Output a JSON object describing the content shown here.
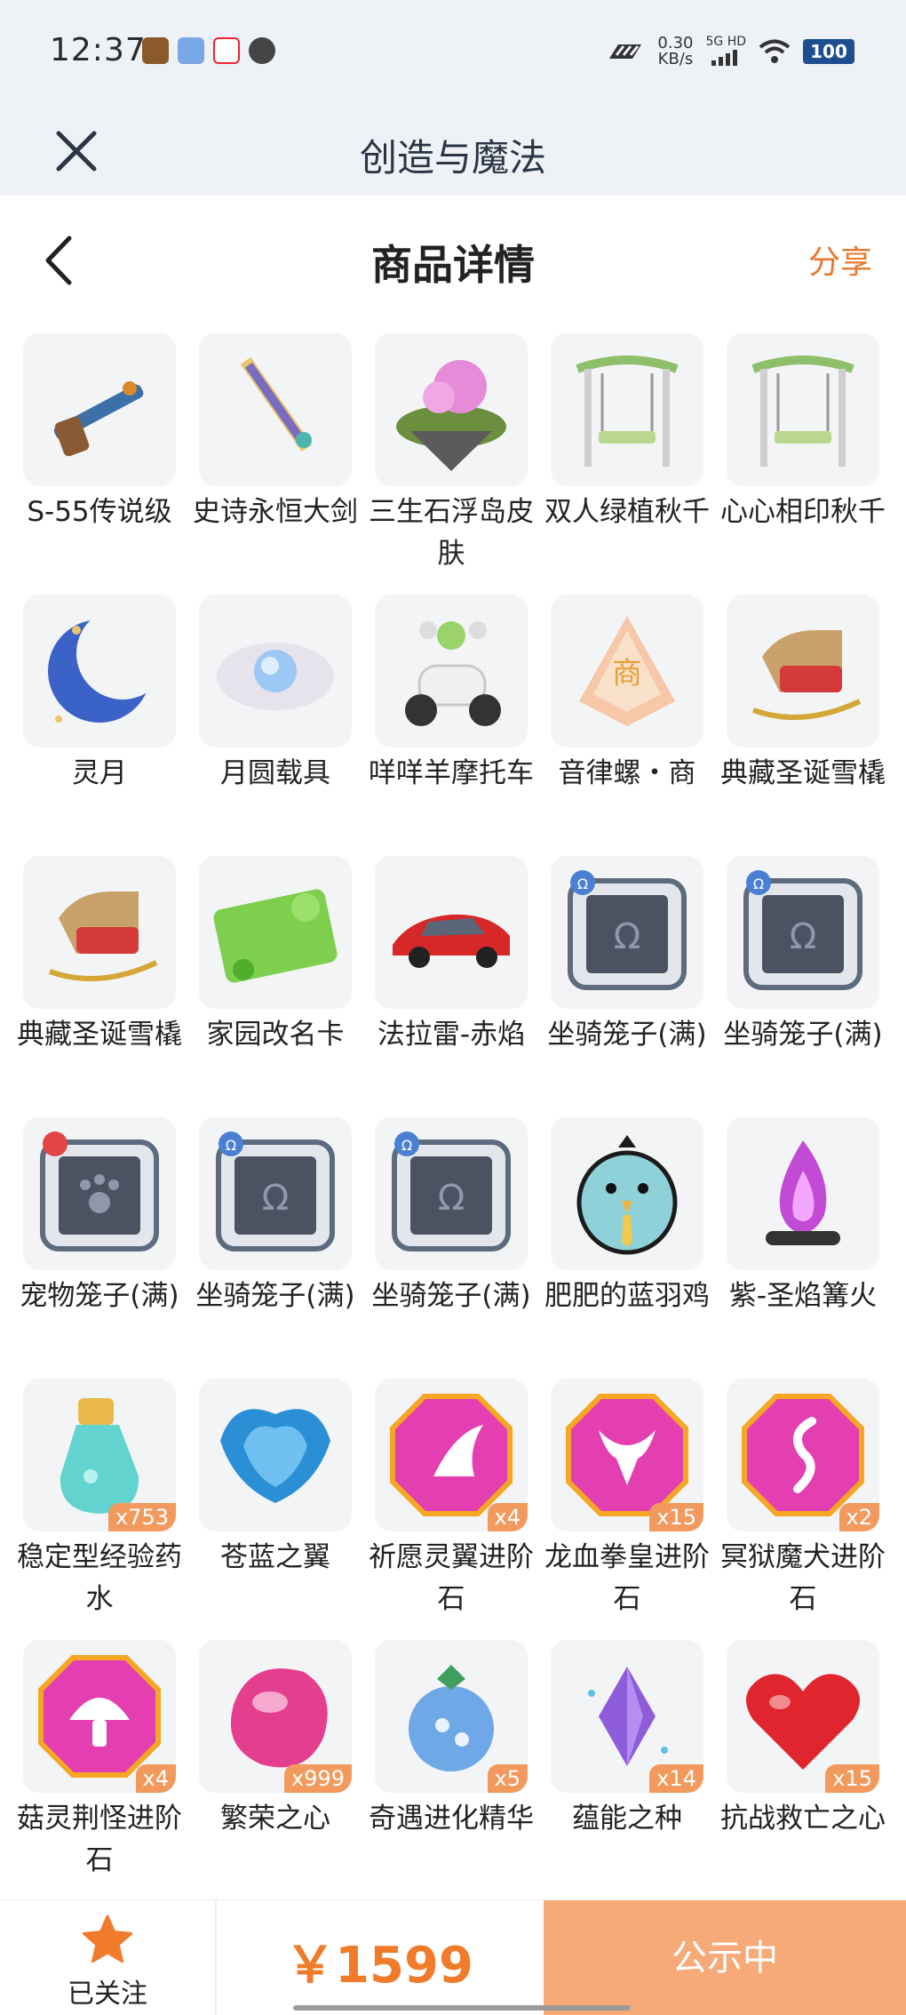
{
  "status_bar": {
    "time": "12:37",
    "net_speed_value": "0.30",
    "net_speed_unit": "KB/s",
    "network": "5G HD",
    "battery": "100"
  },
  "app": {
    "title": "创造与魔法"
  },
  "header": {
    "title": "商品详情",
    "share_label": "分享"
  },
  "items": [
    {
      "name": "S-55传说级",
      "icon": "gun-icon",
      "badge": ""
    },
    {
      "name": "史诗永恒大剑",
      "icon": "sword-icon",
      "badge": ""
    },
    {
      "name": "三生石浮岛皮肤",
      "icon": "floating-island-icon",
      "badge": ""
    },
    {
      "name": "双人绿植秋千",
      "icon": "swing-icon",
      "badge": ""
    },
    {
      "name": "心心相印秋千",
      "icon": "swing-icon",
      "badge": ""
    },
    {
      "name": "灵月",
      "icon": "crescent-moon-icon",
      "badge": ""
    },
    {
      "name": "月圆载具",
      "icon": "cloud-moon-icon",
      "badge": ""
    },
    {
      "name": "咩咩羊摩托车",
      "icon": "scooter-icon",
      "badge": ""
    },
    {
      "name": "音律螺・商",
      "icon": "conch-icon",
      "badge": ""
    },
    {
      "name": "典藏圣诞雪橇",
      "icon": "sleigh-icon",
      "badge": ""
    },
    {
      "name": "典藏圣诞雪橇",
      "icon": "sleigh-icon",
      "badge": ""
    },
    {
      "name": "家园改名卡",
      "icon": "clover-card-icon",
      "badge": ""
    },
    {
      "name": "法拉雷-赤焰",
      "icon": "red-car-icon",
      "badge": ""
    },
    {
      "name": "坐骑笼子(满)",
      "icon": "mount-cage-icon",
      "badge": ""
    },
    {
      "name": "坐骑笼子(满)",
      "icon": "mount-cage-icon",
      "badge": ""
    },
    {
      "name": "宠物笼子(满)",
      "icon": "pet-cage-icon",
      "badge": ""
    },
    {
      "name": "坐骑笼子(满)",
      "icon": "mount-cage-icon",
      "badge": ""
    },
    {
      "name": "坐骑笼子(满)",
      "icon": "mount-cage-icon",
      "badge": ""
    },
    {
      "name": "肥肥的蓝羽鸡",
      "icon": "blue-bird-icon",
      "badge": ""
    },
    {
      "name": "紫-圣焰篝火",
      "icon": "bonfire-icon",
      "badge": ""
    },
    {
      "name": "稳定型经验药水",
      "icon": "potion-icon",
      "badge": "x753"
    },
    {
      "name": "苍蓝之翼",
      "icon": "blue-wings-icon",
      "badge": ""
    },
    {
      "name": "祈愿灵翼进阶石",
      "icon": "wing-gem-icon",
      "badge": "x4"
    },
    {
      "name": "龙血拳皇进阶石",
      "icon": "bull-gem-icon",
      "badge": "x15"
    },
    {
      "name": "冥狱魔犬进阶石",
      "icon": "flame-gem-icon",
      "badge": "x2"
    },
    {
      "name": "菇灵荆怪进阶石",
      "icon": "mushroom-gem-icon",
      "badge": "x4"
    },
    {
      "name": "繁荣之心",
      "icon": "pink-stone-icon",
      "badge": "x999"
    },
    {
      "name": "奇遇进化精华",
      "icon": "blue-fruit-icon",
      "badge": "x5"
    },
    {
      "name": "蕴能之种",
      "icon": "purple-crystal-icon",
      "badge": "x14"
    },
    {
      "name": "抗战救亡之心",
      "icon": "red-heart-icon",
      "badge": "x15"
    }
  ],
  "bottom_bar": {
    "follow_label": "已关注",
    "price": "￥1599",
    "action_label": "公示中"
  },
  "colors": {
    "accent": "#f07b2b",
    "button_bg": "#f7a978",
    "badge_bg": "#f29a5e",
    "header_bg": "#eef2f7"
  }
}
